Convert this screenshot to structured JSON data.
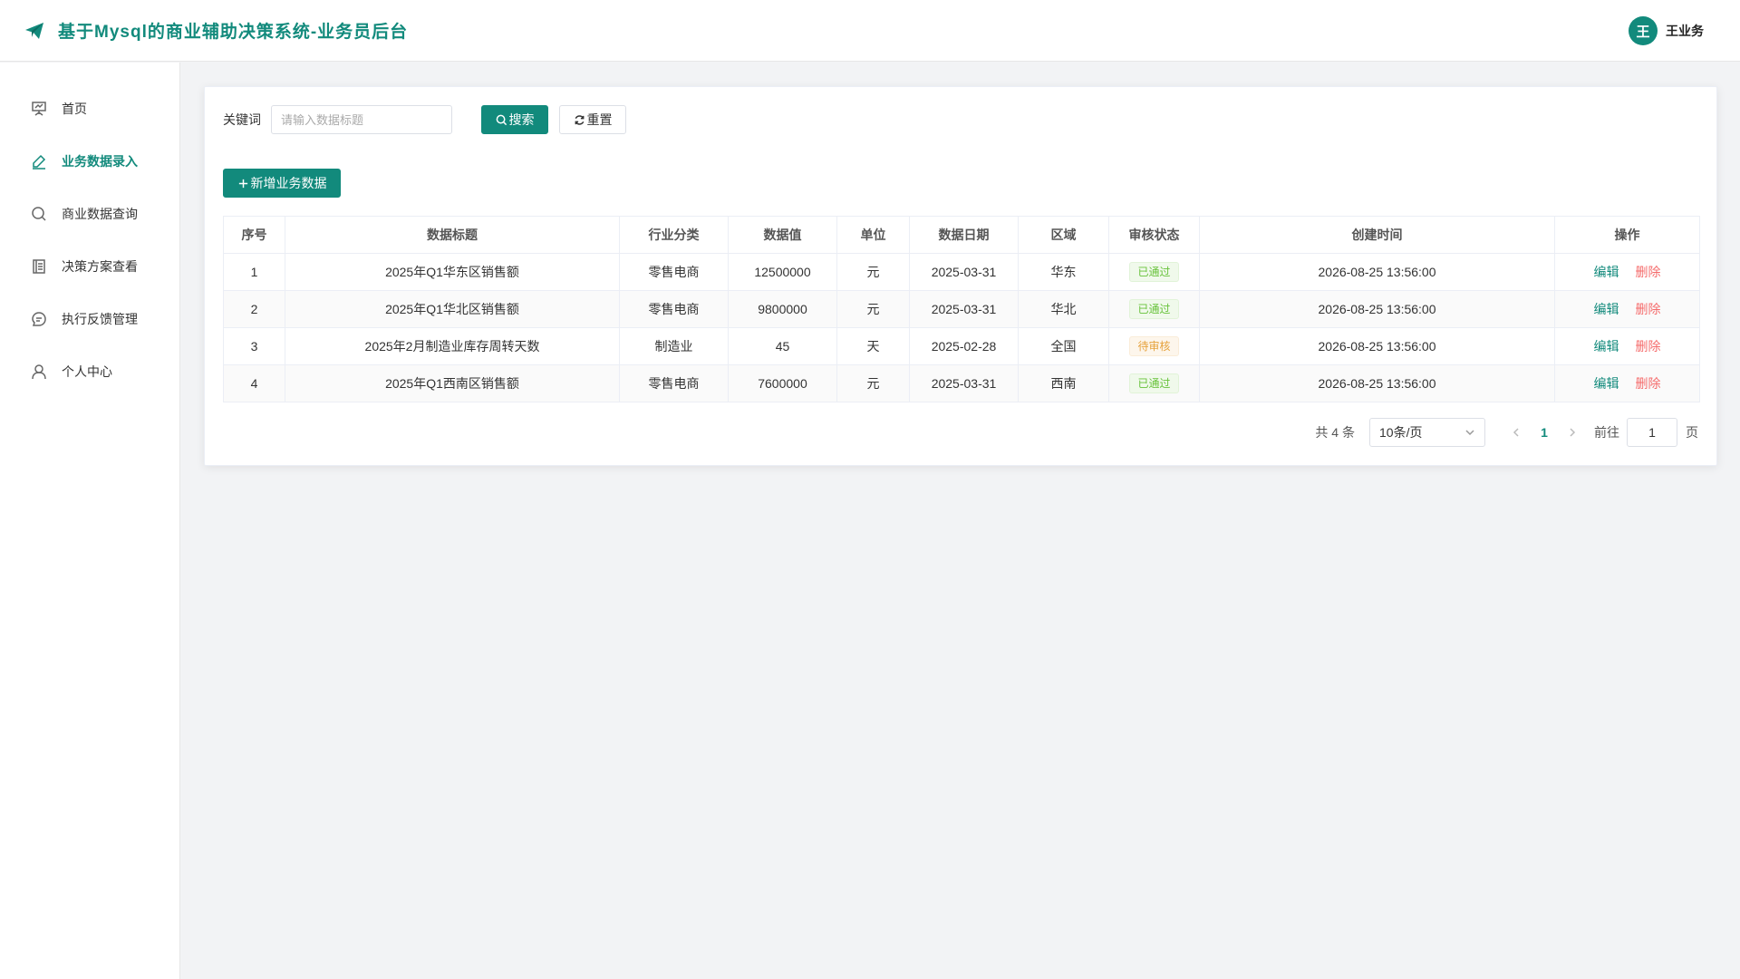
{
  "header": {
    "title": "基于Mysql的商业辅助决策系统-业务员后台",
    "user_avatar_char": "王",
    "user_name": "王业务",
    "brand_color": "#128a7c"
  },
  "sidebar": {
    "items": [
      {
        "label": "首页",
        "icon": "presentation-icon",
        "active": false
      },
      {
        "label": "业务数据录入",
        "icon": "edit-pen-icon",
        "active": true
      },
      {
        "label": "商业数据查询",
        "icon": "search-icon",
        "active": false
      },
      {
        "label": "决策方案查看",
        "icon": "document-icon",
        "active": false
      },
      {
        "label": "执行反馈管理",
        "icon": "chat-icon",
        "active": false
      },
      {
        "label": "个人中心",
        "icon": "user-icon",
        "active": false
      }
    ]
  },
  "search": {
    "label": "关键词",
    "placeholder": "请输入数据标题",
    "value": "",
    "search_btn": "搜索",
    "reset_btn": "重置"
  },
  "add_button": "新增业务数据",
  "table": {
    "columns": [
      "序号",
      "数据标题",
      "行业分类",
      "数据值",
      "单位",
      "数据日期",
      "区域",
      "审核状态",
      "创建时间",
      "操作"
    ],
    "rows": [
      {
        "index": "1",
        "title": "2025年Q1华东区销售额",
        "category": "零售电商",
        "value": "12500000",
        "unit": "元",
        "date": "2025-03-31",
        "region": "华东",
        "status": "已通过",
        "status_type": "ok",
        "created": "2026-08-25 13:56:00"
      },
      {
        "index": "2",
        "title": "2025年Q1华北区销售额",
        "category": "零售电商",
        "value": "9800000",
        "unit": "元",
        "date": "2025-03-31",
        "region": "华北",
        "status": "已通过",
        "status_type": "ok",
        "created": "2026-08-25 13:56:00"
      },
      {
        "index": "3",
        "title": "2025年2月制造业库存周转天数",
        "category": "制造业",
        "value": "45",
        "unit": "天",
        "date": "2025-02-28",
        "region": "全国",
        "status": "待审核",
        "status_type": "pending",
        "created": "2026-08-25 13:56:00"
      },
      {
        "index": "4",
        "title": "2025年Q1西南区销售额",
        "category": "零售电商",
        "value": "7600000",
        "unit": "元",
        "date": "2025-03-31",
        "region": "西南",
        "status": "已通过",
        "status_type": "ok",
        "created": "2026-08-25 13:56:00"
      }
    ],
    "edit_label": "编辑",
    "delete_label": "删除"
  },
  "pagination": {
    "total_text": "共 4 条",
    "page_size": "10条/页",
    "current_page": "1",
    "goto_label": "前往",
    "goto_value": "1",
    "page_suffix": "页"
  }
}
